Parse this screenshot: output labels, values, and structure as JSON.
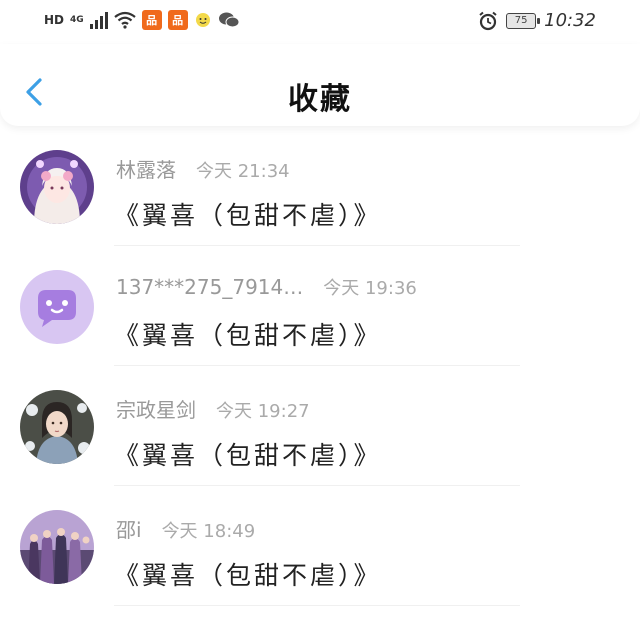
{
  "status_bar": {
    "hd": "HD",
    "network": "4G",
    "battery": "75",
    "time": "10:32"
  },
  "header": {
    "title": "收藏"
  },
  "favorites": [
    {
      "user": "林露落",
      "time": "今天 21:34",
      "title": "《翼喜（包甜不虐）》"
    },
    {
      "user": "137***275_7914…",
      "time": "今天 19:36",
      "title": "《翼喜（包甜不虐）》"
    },
    {
      "user": "宗政星剑",
      "time": "今天 19:27",
      "title": "《翼喜（包甜不虐）》"
    },
    {
      "user": "邵i",
      "time": "今天 18:49",
      "title": "《翼喜（包甜不虐）》"
    }
  ],
  "colors": {
    "accent": "#3da0e6",
    "default_avatar_bg": "#d8c6f2",
    "default_avatar_icon": "#a67de0"
  }
}
